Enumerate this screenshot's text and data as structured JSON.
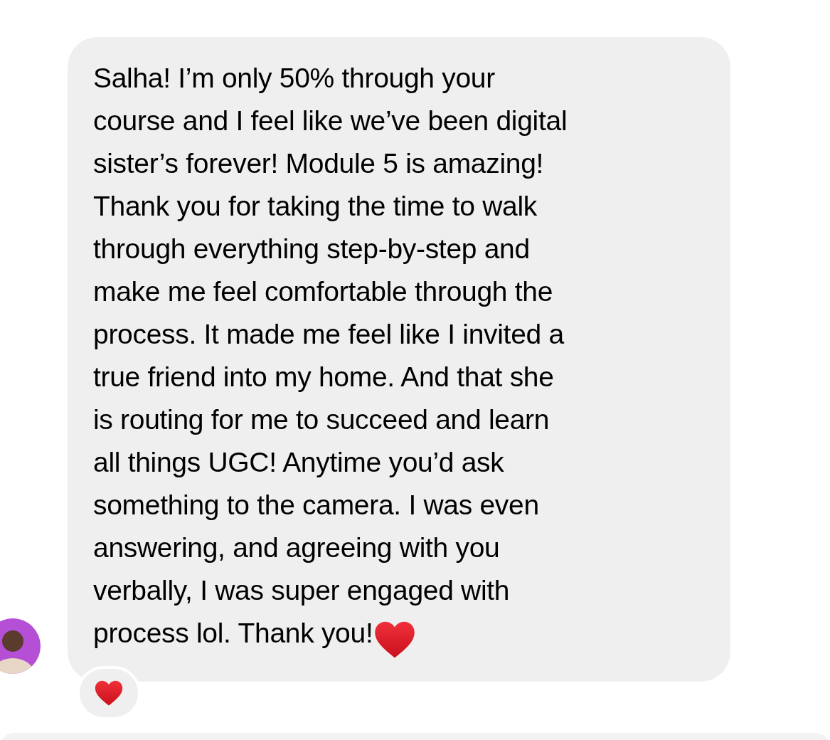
{
  "message": {
    "lines": [
      "Salha! I’m only 50% through your",
      "course and I feel like we’ve been digital",
      "sister’s forever! Module 5 is amazing!",
      "Thank you for taking the time to walk",
      "through everything step-by-step and",
      "make me feel comfortable through the",
      "process. It made me feel like I invited a",
      "true friend into my home. And that she",
      "is routing for me to succeed and learn",
      "all things UGC! Anytime you’d ask",
      "something to the camera. I was even",
      "answering, and agreeing with you",
      "verbally, I was super engaged with",
      "process lol. Thank you!"
    ],
    "ends_with_heart": true,
    "has_heart_reaction": true
  }
}
